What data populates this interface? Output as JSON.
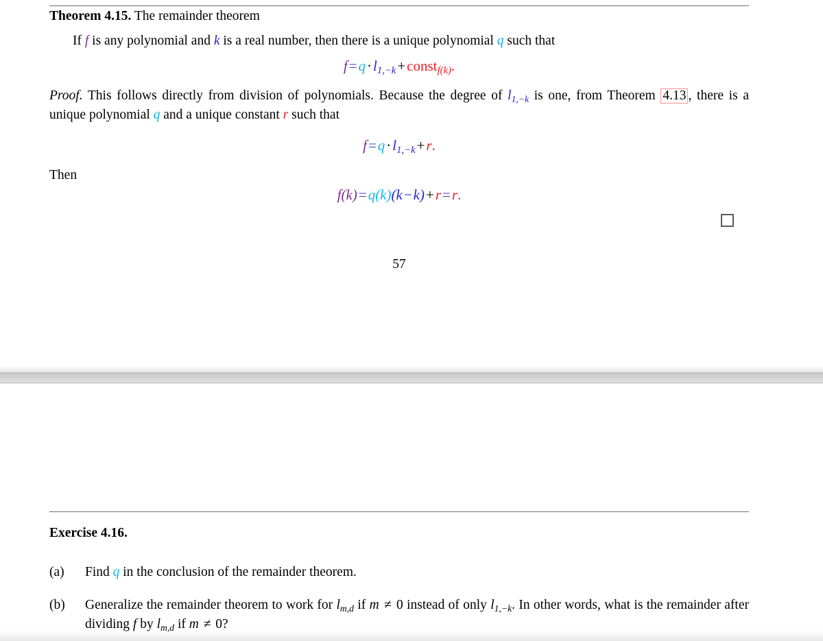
{
  "document": {
    "page_number": "57"
  },
  "theorem": {
    "label": "Theorem 4.15.",
    "title": "The remainder theorem",
    "statement_pre": "If ",
    "statement_f": "f",
    "statement_mid": " is any polynomial and ",
    "statement_k": "k",
    "statement_post": " is a real number, then there is a unique polynomial ",
    "statement_q": "q",
    "statement_end": " such that"
  },
  "equations": {
    "eq1": {
      "lhs": "f",
      "eq": "=",
      "q": "q",
      "dot": "·",
      "l": "l",
      "l_sub": "1,−k",
      "plus": "+",
      "const": "const",
      "const_sub": "f(k)",
      "period": "."
    },
    "eq2": {
      "lhs": "f",
      "eq": "=",
      "q": "q",
      "dot": "·",
      "l": "l",
      "l_sub": "1,−k",
      "plus": "+",
      "r": "r",
      "period": "."
    },
    "eq3": {
      "lhs_f": "f",
      "lhs_arg": "(k)",
      "eq1": "=",
      "q": "q",
      "q_arg": "(k)",
      "factor_open": "(",
      "factor_k1": "k",
      "minus": "−",
      "factor_k2": "k",
      "factor_close": ")",
      "plus": "+",
      "r1": "r",
      "eq2": "=",
      "r2": "r",
      "period": "."
    }
  },
  "proof": {
    "label": "Proof.",
    "text1": " This follows directly from division of polynomials. Because the degree of ",
    "l": "l",
    "l_sub": "1,−k",
    "text2": " is one, from Theorem ",
    "link": "4.13",
    "text3": ", there is a unique polynomial ",
    "q": "q",
    "text4": " and a unique constant ",
    "r": "r",
    "text5": " such that",
    "then": "Then",
    "qed_symbol": "□"
  },
  "exercise": {
    "heading": "Exercise 4.16.",
    "items": [
      {
        "tag": "(a)",
        "pre": "Find ",
        "var": "q",
        "post": " in the conclusion of the remainder theorem."
      },
      {
        "tag": "(b)",
        "pre": "Generalize the remainder theorem to work for ",
        "lmd1": "l",
        "lmd1_sub": "m,d",
        "mid1": " if ",
        "m1": "m",
        "neq1": " ≠ ",
        "zero1": "0",
        "mid2": " instead of only ",
        "lk": "l",
        "lk_sub": "1,−k",
        "mid3": ". In other words, what is the remainder after dividing ",
        "f": "f",
        "mid4": " by ",
        "lmd2": "l",
        "lmd2_sub": "m,d",
        "mid5": " if ",
        "m2": "m",
        "neq2": " ≠ ",
        "zero2": "0",
        "end": "?"
      }
    ]
  },
  "colors": {
    "f": "#7B2D8E",
    "q": "#13B5EA",
    "l": "#2A22CF",
    "k": "#2A22CF",
    "const": "#EE1C25",
    "r": "#EE1C25",
    "link_box": "#F2918F",
    "rule": "#6F6F6F"
  }
}
